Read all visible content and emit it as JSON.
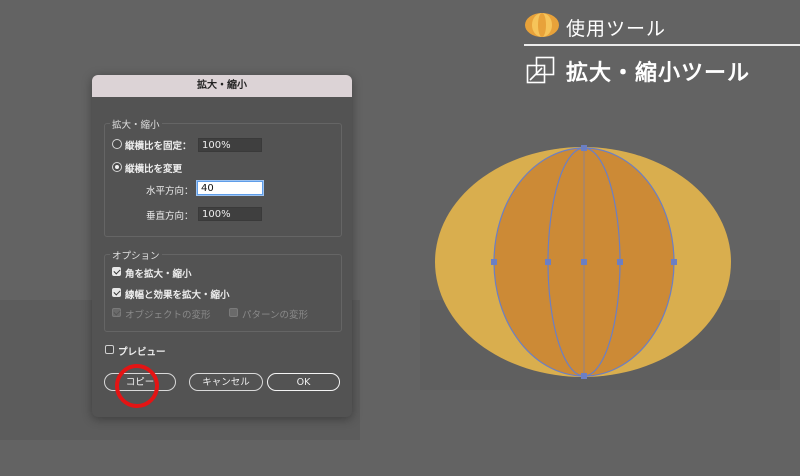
{
  "dialog": {
    "title": "拡大・縮小",
    "scale_group": {
      "title": "拡大・縮小",
      "uniform_label": "縦横比を固定：",
      "uniform_value": "100%",
      "non_uniform_label": "縦横比を変更",
      "horizontal_label": "水平方向：",
      "horizontal_value": "40",
      "vertical_label": "垂直方向：",
      "vertical_value": "100%",
      "selected": "non_uniform"
    },
    "options_group": {
      "title": "オプション",
      "scale_corners": {
        "label": "角を拡大・縮小",
        "checked": true
      },
      "scale_strokes": {
        "label": "線幅と効果を拡大・縮小",
        "checked": true
      },
      "transform_objects": {
        "label": "オブジェクトの変形",
        "checked": true,
        "disabled": true
      },
      "transform_patterns": {
        "label": "パターンの変形",
        "checked": false,
        "disabled": true
      }
    },
    "preview": {
      "label": "プレビュー",
      "checked": false
    },
    "buttons": {
      "copy": "コピー",
      "cancel": "キャンセル",
      "ok": "OK"
    }
  },
  "header": {
    "title": "使用ツール",
    "tool_name": "拡大・縮小ツール"
  },
  "colors": {
    "accent_orange": "#E8A23A",
    "outer_ellipse": "#D9AE4E",
    "inner_ellipse": "#CC8A36",
    "selection_blue": "#6B7FC4",
    "highlight_red": "#E41414"
  }
}
